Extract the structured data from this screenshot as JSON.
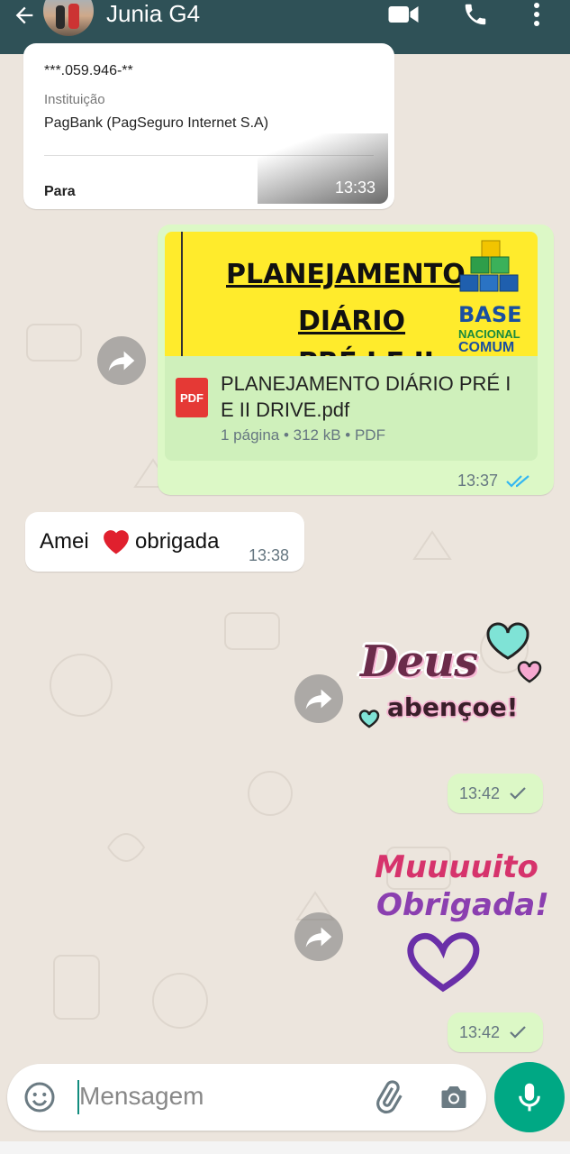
{
  "header": {
    "contact_name": "Junia G4",
    "back_icon": "arrow-left-icon",
    "video_icon": "video-call-icon",
    "call_icon": "phone-icon",
    "menu_icon": "more-vert-icon",
    "color": "#2F5157"
  },
  "messages": [
    {
      "type": "receipt",
      "direction": "in",
      "masked_id": "***.059.946-**",
      "institution_label": "Instituição",
      "institution_value": "PagBank (PagSeguro Internet S.A)",
      "to_label": "Para",
      "time": "13:33"
    },
    {
      "type": "document",
      "direction": "out",
      "preview_title_line1": "PLANEJAMENTO",
      "preview_title_line2": "DIÁRIO",
      "preview_title_line3": "PRÉ I E II",
      "preview_logo_base": "BASE",
      "preview_logo_nacional": "NACIONAL",
      "preview_logo_comum": "COMUM",
      "file_badge": "PDF",
      "file_name": "PLANEJAMENTO DIÁRIO PRÉ I E II DRIVE.pdf",
      "file_meta": "1 página • 312 kB • PDF",
      "time": "13:37",
      "status": "read"
    },
    {
      "type": "text",
      "direction": "in",
      "text_before": "Amei",
      "text_after": "obrigada",
      "emoji": "heart",
      "time": "13:38"
    },
    {
      "type": "sticker",
      "direction": "out",
      "sticker_line1": "Deus",
      "sticker_line2": "abençoe!",
      "time": "13:42",
      "status": "sent"
    },
    {
      "type": "sticker",
      "direction": "out",
      "sticker_line1": "Muuuuito",
      "sticker_line2": "Obrigada!",
      "time": "13:42",
      "status": "sent"
    }
  ],
  "composer": {
    "placeholder": "Mensagem",
    "emoji_icon": "emoji-icon",
    "attach_icon": "paperclip-icon",
    "camera_icon": "camera-icon",
    "mic_icon": "microphone-icon",
    "accent": "#00A884"
  }
}
